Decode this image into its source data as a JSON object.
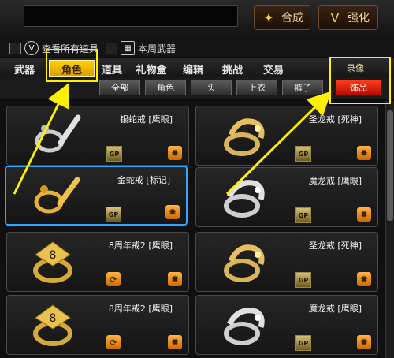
{
  "top": {
    "compose_label": "合成",
    "enhance_label": "强化"
  },
  "filters": {
    "show_all": "查看所有道具",
    "this_week": "本周武器"
  },
  "tabs": [
    "武器",
    "角色",
    "道具",
    "礼物盒",
    "编辑",
    "挑战",
    "交易"
  ],
  "active_tab": "角色",
  "recommend_label": "录像",
  "subtabs": [
    "全部",
    "角色",
    "头",
    "上衣",
    "裤子",
    "饰品"
  ],
  "active_subtab": "饰品",
  "items": [
    {
      "name": "银蛇戒 [鹰眼]",
      "gp": "GP 刷新"
    },
    {
      "name": "圣龙戒 [死神]",
      "gp": "GP 刷新"
    },
    {
      "name": "金蛇戒 [标记]",
      "gp": "GP 刷新"
    },
    {
      "name": "魔龙戒 [鹰眼]",
      "gp": "GP 刷新"
    },
    {
      "name": "8周年戒2 [鹰眼]",
      "gp": ""
    },
    {
      "name": "圣龙戒 [死神]",
      "gp": "GP 刷新"
    },
    {
      "name": "8周年戒2 [鹰眼]",
      "gp": ""
    },
    {
      "name": "魔龙戒 [鹰眼]",
      "gp": "GP 刷新"
    }
  ],
  "colors": {
    "accent_yellow": "#ffef00",
    "selection_blue": "#2fa6ff",
    "active_red": "#d81a00"
  }
}
